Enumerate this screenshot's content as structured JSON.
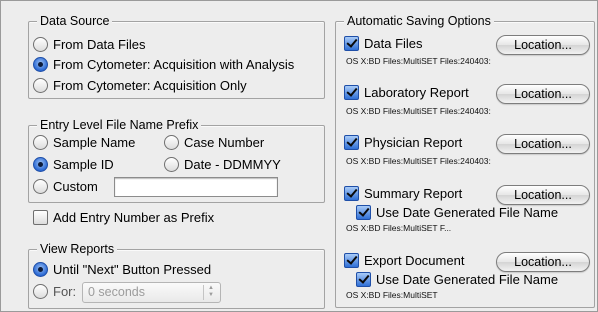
{
  "data_source": {
    "title": "Data Source",
    "options": [
      {
        "label": "From Data Files",
        "selected": false
      },
      {
        "label": "From Cytometer: Acquisition with Analysis",
        "selected": true
      },
      {
        "label": "From Cytometer: Acquisition Only",
        "selected": false
      }
    ]
  },
  "prefix": {
    "title": "Entry Level File Name Prefix",
    "sample_name": "Sample Name",
    "case_number": "Case Number",
    "sample_id": "Sample ID",
    "date": "Date - DDMMYY",
    "custom": "Custom",
    "custom_value": "",
    "selected": "sample_id"
  },
  "add_entry": {
    "label": "Add Entry Number as Prefix",
    "checked": false
  },
  "view_reports": {
    "title": "View Reports",
    "until_label": "Until \"Next\" Button Pressed",
    "for_label": "For:",
    "for_value": "0 seconds",
    "selected": "until"
  },
  "auto_save": {
    "title": "Automatic Saving Options",
    "location_label": "Location...",
    "date_name_label": "Use Date Generated File Name",
    "items": [
      {
        "label": "Data Files",
        "checked": true,
        "path": "OS X:BD Files:MultiSET Files:240403:"
      },
      {
        "label": "Laboratory Report",
        "checked": true,
        "path": "OS X:BD Files:MultiSET Files:240403:"
      },
      {
        "label": "Physician Report",
        "checked": true,
        "path": "OS X:BD Files:MultiSET Files:240403:"
      },
      {
        "label": "Summary Report",
        "checked": true,
        "use_date": true,
        "path": "OS X:BD Files:MultiSET F..."
      },
      {
        "label": "Export Document",
        "checked": true,
        "use_date": true,
        "path": "OS X:BD Files:MultiSET"
      }
    ]
  },
  "colors": {
    "accent": "#2b69d3",
    "background": "#ededed",
    "border": "#a3a3a3"
  }
}
